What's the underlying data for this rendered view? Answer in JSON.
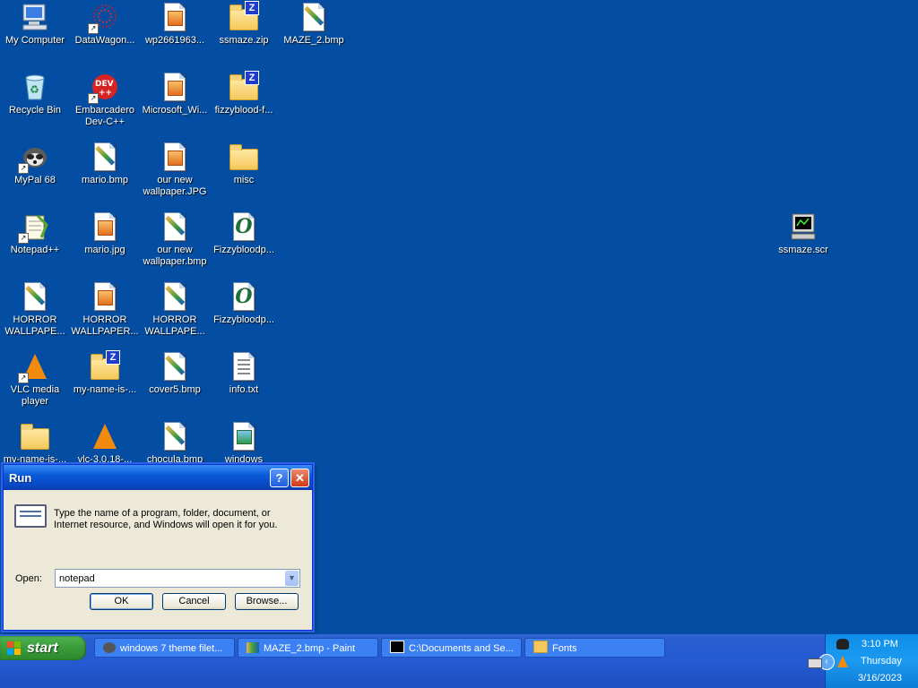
{
  "desktop": {
    "icons": [
      {
        "label": "My Computer"
      },
      {
        "label": "DataWagon..."
      },
      {
        "label": "wp2661963..."
      },
      {
        "label": "ssmaze.zip"
      },
      {
        "label": "MAZE_2.bmp"
      },
      {
        "label": "Recycle Bin"
      },
      {
        "label": "Embarcadero\nDev-C++"
      },
      {
        "label": "Microsoft_Wi..."
      },
      {
        "label": "fizzyblood-f..."
      },
      {
        "label": "MyPal 68"
      },
      {
        "label": "mario.bmp"
      },
      {
        "label": "our new\nwallpaper.JPG"
      },
      {
        "label": "misc"
      },
      {
        "label": "Notepad++"
      },
      {
        "label": "mario.jpg"
      },
      {
        "label": "our new\nwallpaper.bmp"
      },
      {
        "label": "Fizzybloodp..."
      },
      {
        "label": "HORROR\nWALLPAPE..."
      },
      {
        "label": "HORROR\nWALLPAPER..."
      },
      {
        "label": "HORROR\nWALLPAPE..."
      },
      {
        "label": "Fizzybloodp..."
      },
      {
        "label": "VLC media\nplayer"
      },
      {
        "label": "my-name-is-..."
      },
      {
        "label": "cover5.bmp"
      },
      {
        "label": "info.txt"
      },
      {
        "label": "my-name-is-..."
      },
      {
        "label": "vlc-3.0.18-..."
      },
      {
        "label": "chocula.bmp"
      },
      {
        "label": "windows"
      },
      {
        "label": "ssmaze.scr"
      }
    ]
  },
  "run_dialog": {
    "title": "Run",
    "help_glyph": "?",
    "close_glyph": "✕",
    "description": "Type the name of a program, folder, document, or Internet resource, and Windows will open it for you.",
    "open_label": "Open:",
    "open_value": "notepad",
    "ok_label": "OK",
    "cancel_label": "Cancel",
    "browse_label": "Browse..."
  },
  "taskbar": {
    "start_label": "start",
    "tasks": [
      {
        "label": "windows 7 theme filet..."
      },
      {
        "label": "MAZE_2.bmp - Paint"
      },
      {
        "label": "C:\\Documents and Se..."
      },
      {
        "label": "Fonts"
      }
    ],
    "clock": {
      "time": "3:10 PM",
      "day": "Thursday",
      "date": "3/16/2023"
    }
  },
  "colors": {
    "desktop_background": "#034ea2",
    "taskbar": "#245ad3",
    "start_button": "#3a9a3a",
    "tray": "#1b9af0"
  }
}
